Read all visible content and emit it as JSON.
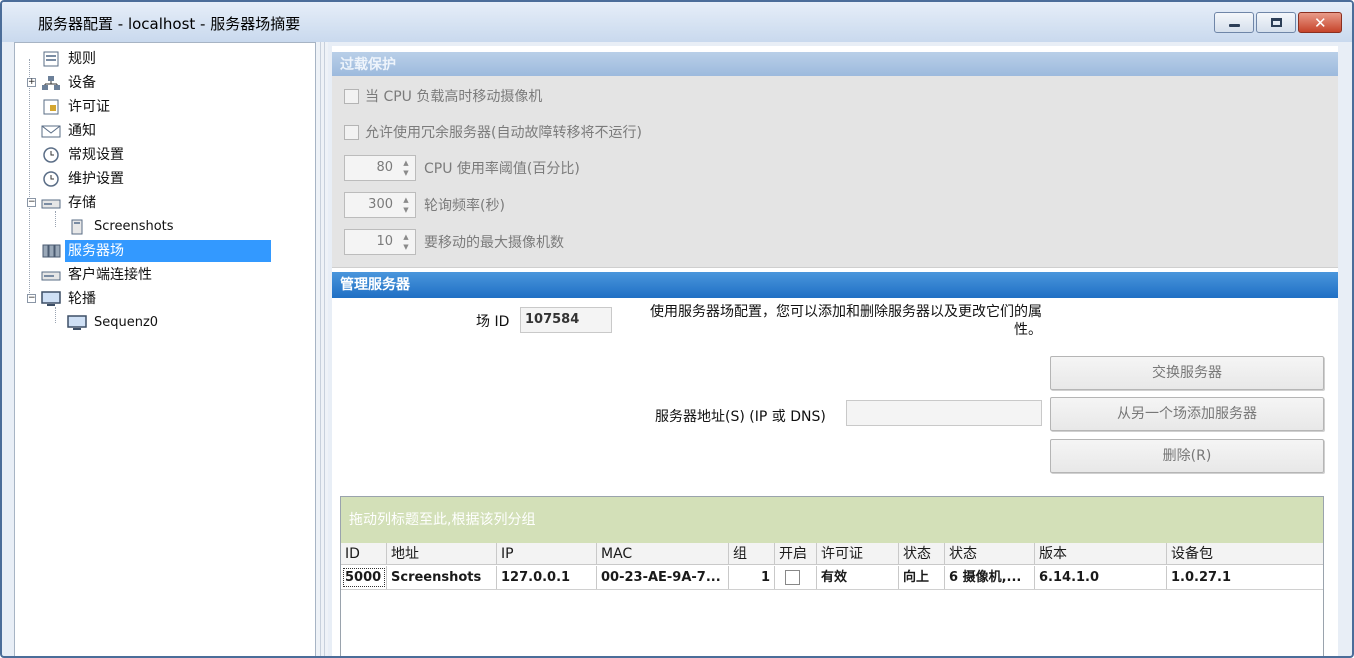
{
  "window": {
    "title": "服务器配置 - localhost - 服务器场摘要",
    "close_glyph": "✕"
  },
  "tree": {
    "items": [
      {
        "label": "规则",
        "icon": "rules-icon"
      },
      {
        "label": "设备",
        "icon": "network-icon",
        "expander": "+"
      },
      {
        "label": "许可证",
        "icon": "license-icon"
      },
      {
        "label": "通知",
        "icon": "envelope-icon"
      },
      {
        "label": "常规设置",
        "icon": "clock-icon"
      },
      {
        "label": "维护设置",
        "icon": "clock-icon"
      },
      {
        "label": "存储",
        "icon": "drive-icon",
        "expander": "−"
      },
      {
        "label": "Screenshots",
        "icon": "storage-volume-icon"
      },
      {
        "label": "服务器场",
        "icon": "server-farm-icon",
        "selected": true
      },
      {
        "label": "客户端连接性",
        "icon": "client-icon"
      },
      {
        "label": "轮播",
        "icon": "monitor-icon",
        "expander": "−"
      },
      {
        "label": "Sequenz0",
        "icon": "monitor-icon"
      }
    ]
  },
  "overload": {
    "header": "过载保护",
    "move_cameras_label": "当 CPU 负载高时移动摄像机",
    "allow_redundant_label": "允许使用冗余服务器(自动故障转移将不运行)",
    "cpu_threshold": {
      "value": "80",
      "label": "CPU 使用率阈值(百分比)"
    },
    "poll_rate": {
      "value": "300",
      "label": "轮询频率(秒)"
    },
    "max_cameras": {
      "value": "10",
      "label": "要移动的最大摄像机数"
    }
  },
  "manage": {
    "header": "管理服务器",
    "farm_id_label": "场 ID",
    "farm_id_value": "107584",
    "description": "使用服务器场配置，您可以添加和删除服务器以及更改它们的属性。",
    "server_address_label": "服务器地址(S) (IP 或 DNS)",
    "server_address_value": "",
    "swap_button": "交换服务器",
    "add_from_farm_button": "从另一个场添加服务器",
    "delete_button": "删除(R)"
  },
  "grid": {
    "group_hint": "拖动列标题至此,根据该列分组",
    "columns": [
      "ID",
      "地址",
      "IP",
      "MAC",
      "组",
      "开启",
      "许可证",
      "状态",
      "状态",
      "版本",
      "设备包"
    ],
    "rows": [
      {
        "id": "5000",
        "address": "Screenshots",
        "ip": "127.0.0.1",
        "mac": "00-23-AE-9A-7...",
        "group": "1",
        "enabled": false,
        "license": "有效",
        "status": "向上",
        "status2": "6 摄像机,...",
        "version": "6.14.1.0",
        "device_pack": "1.0.27.1"
      }
    ]
  },
  "colors": {
    "selection": "#3399ff",
    "section_header": "#1f6fc4",
    "group_panel": "#d3e0b8"
  }
}
